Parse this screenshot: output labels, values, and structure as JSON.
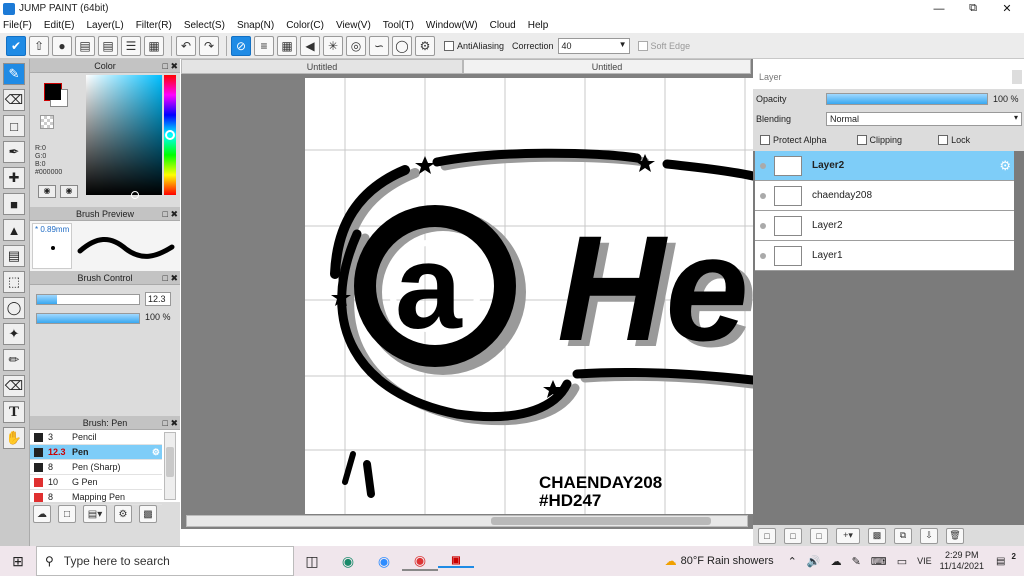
{
  "window": {
    "title": "JUMP PAINT (64bit)"
  },
  "menu": [
    "File(F)",
    "Edit(E)",
    "Layer(L)",
    "Filter(R)",
    "Select(S)",
    "Snap(N)",
    "Color(C)",
    "View(V)",
    "Tool(T)",
    "Window(W)",
    "Cloud",
    "Help"
  ],
  "toolbar": {
    "antialiasing_label": "AntiAliasing",
    "correction_label": "Correction",
    "correction_value": "40",
    "soft_edge_label": "Soft Edge"
  },
  "color_panel": {
    "title": "Color",
    "r": "R:0",
    "g": "G:0",
    "b": "B:0",
    "hex": "#000000",
    "fg": "#000000",
    "bg": "#ffffff"
  },
  "brush_preview": {
    "title": "Brush Preview",
    "size": "* 0.89mm"
  },
  "brush_control": {
    "title": "Brush Control",
    "size_value": "12.3",
    "opacity_value": "100 %",
    "size_fraction": 0.2,
    "opacity_fraction": 1.0
  },
  "brush_list": {
    "title": "Brush: Pen",
    "items": [
      {
        "size": "3",
        "name": "Pencil",
        "color": "#222222",
        "selected": false
      },
      {
        "size": "12.3",
        "name": "Pen",
        "color": "#222222",
        "selected": true
      },
      {
        "size": "8",
        "name": "Pen (Sharp)",
        "color": "#222222",
        "selected": false
      },
      {
        "size": "10",
        "name": "G Pen",
        "color": "#e03030",
        "selected": false
      },
      {
        "size": "8",
        "name": "Mapping Pen",
        "color": "#e03030",
        "selected": false
      }
    ]
  },
  "tabs": [
    "Untitled",
    "Untitled"
  ],
  "canvas": {
    "watermark_line1": "CHAENDAY208",
    "watermark_line2": "#HD247"
  },
  "layer_panel": {
    "title": "Layer",
    "opacity_label": "Opacity",
    "opacity_value": "100 %",
    "opacity_fraction": 1.0,
    "blending_label": "Blending",
    "blending_value": "Normal",
    "protect_alpha": "Protect Alpha",
    "clipping": "Clipping",
    "lock": "Lock",
    "layers": [
      {
        "name": "Layer2",
        "selected": true
      },
      {
        "name": "chaenday208",
        "selected": false
      },
      {
        "name": "Layer2",
        "selected": false
      },
      {
        "name": "Layer1",
        "selected": false
      }
    ]
  },
  "taskbar": {
    "search_placeholder": "Type here to search",
    "weather": "80°F  Rain showers",
    "lang": "VIE",
    "time": "2:29 PM",
    "date": "11/14/2021",
    "notif": "2"
  },
  "colors": {
    "accent": "#1f8be5",
    "selected_row": "#7ecdf8",
    "panel": "#dcdcdc",
    "canvas_bg": "#808080"
  }
}
